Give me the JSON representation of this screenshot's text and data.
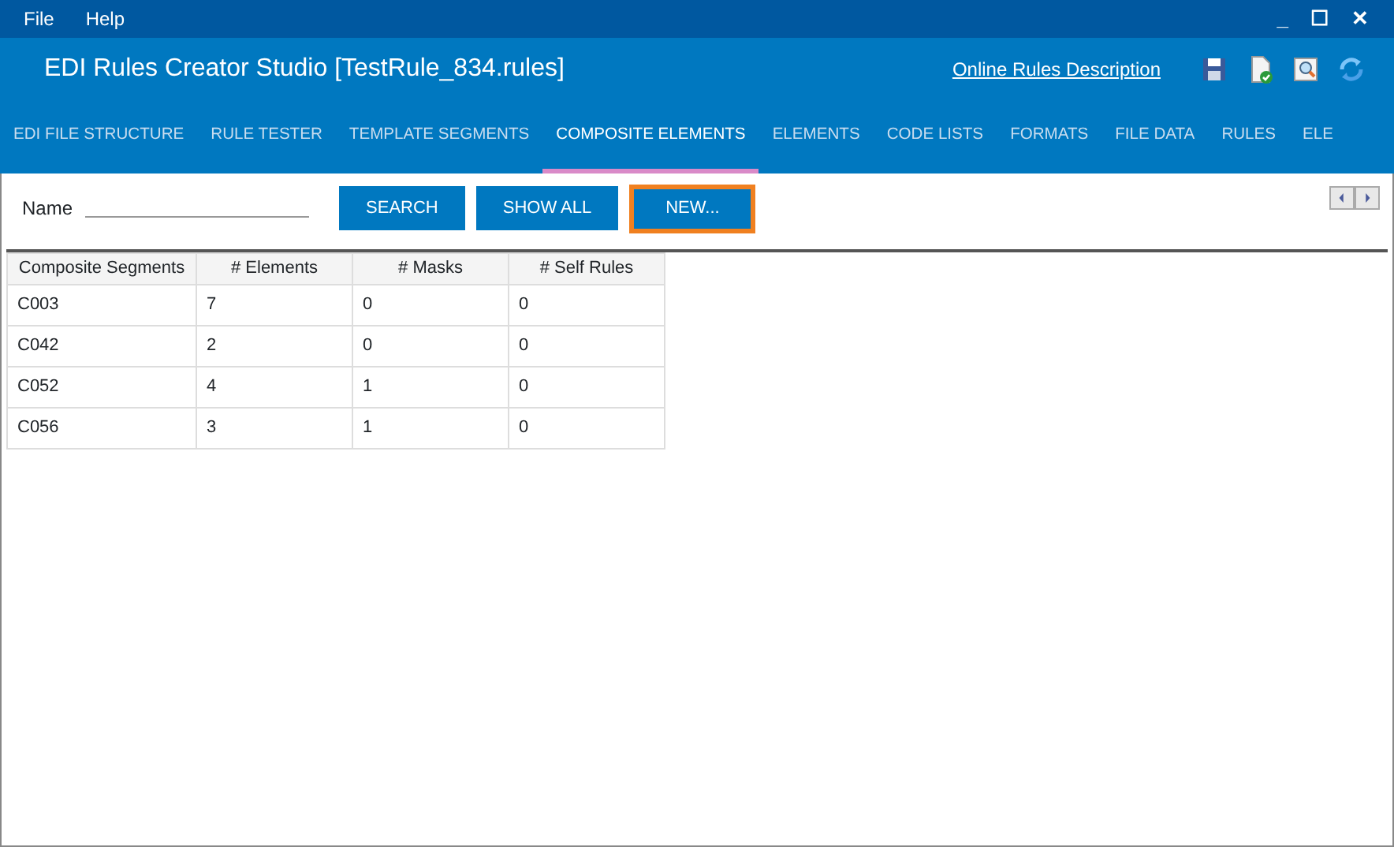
{
  "menu": [
    "File",
    "Help"
  ],
  "window_controls": [
    "_",
    "☐",
    "✕"
  ],
  "window": {
    "title": "EDI Rules Creator Studio [TestRule_834.rules]",
    "link": "Online Rules Description"
  },
  "toolbar": [
    {
      "kind": "save"
    },
    {
      "kind": "validate"
    },
    {
      "kind": "preview"
    },
    {
      "kind": "refresh"
    }
  ],
  "tabs": [
    {
      "label": "EDI FILE STRUCTURE",
      "selected": false
    },
    {
      "label": "RULE TESTER",
      "selected": false
    },
    {
      "label": "TEMPLATE SEGMENTS",
      "selected": false
    },
    {
      "label": "COMPOSITE ELEMENTS",
      "selected": true
    },
    {
      "label": "ELEMENTS",
      "selected": false
    },
    {
      "label": "CODE LISTS",
      "selected": false
    },
    {
      "label": "FORMATS",
      "selected": false
    },
    {
      "label": "FILE DATA",
      "selected": false
    },
    {
      "label": "RULES",
      "selected": false
    },
    {
      "label": "ELE",
      "selected": false
    }
  ],
  "search": {
    "label": "Name"
  },
  "buttons": [
    {
      "label": "SEARCH",
      "focused": false
    },
    {
      "label": "SHOW ALL",
      "focused": false
    },
    {
      "label": "NEW...",
      "focused": true
    }
  ],
  "table": {
    "columns": [
      "Composite Segments",
      "# Elements",
      "# Masks",
      "# Self Rules"
    ],
    "rows": [
      [
        "C003",
        "7",
        "0",
        "0"
      ],
      [
        "C042",
        "2",
        "0",
        "0"
      ],
      [
        "C052",
        "4",
        "1",
        "0"
      ],
      [
        "C056",
        "3",
        "1",
        "0"
      ]
    ]
  }
}
